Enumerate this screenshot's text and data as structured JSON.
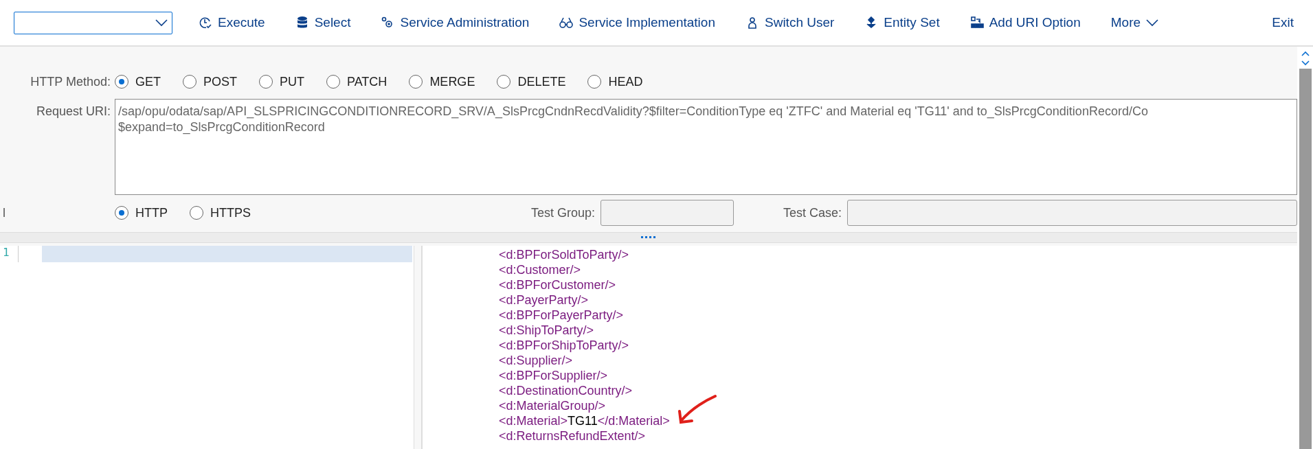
{
  "toolbar": {
    "buttons": [
      {
        "kind": "execute",
        "label": "Execute"
      },
      {
        "kind": "select",
        "label": "Select"
      },
      {
        "kind": "admin",
        "label": "Service Administration"
      },
      {
        "kind": "implementation",
        "label": "Service Implementation"
      },
      {
        "kind": "user",
        "label": "Switch User"
      },
      {
        "kind": "entity",
        "label": "Entity Set"
      },
      {
        "kind": "uri",
        "label": "Add URI Option"
      },
      {
        "kind": "more",
        "label": "More"
      }
    ],
    "exit": "Exit"
  },
  "http_method": {
    "label": "HTTP Method:",
    "options": [
      {
        "label": "GET",
        "selected": true
      },
      {
        "label": "POST",
        "selected": false
      },
      {
        "label": "PUT",
        "selected": false
      },
      {
        "label": "PATCH",
        "selected": false
      },
      {
        "label": "MERGE",
        "selected": false
      },
      {
        "label": "DELETE",
        "selected": false
      },
      {
        "label": "HEAD",
        "selected": false
      }
    ]
  },
  "request_uri": {
    "label": "Request URI:",
    "value": "/sap/opu/odata/sap/API_SLSPRICINGCONDITIONRECORD_SRV/A_SlsPrcgCndnRecdValidity?$filter=ConditionType eq 'ZTFC' and Material eq 'TG11' and to_SlsPrcgConditionRecord/Co\n$expand=to_SlsPrcgConditionRecord"
  },
  "protocol": {
    "label": "l",
    "options": [
      {
        "label": "HTTP",
        "selected": true
      },
      {
        "label": "HTTPS",
        "selected": false
      }
    ]
  },
  "test_group": {
    "label": "Test Group:"
  },
  "test_case": {
    "label": "Test Case:"
  },
  "request_editor": {
    "lines": [
      {
        "number": "1",
        "selected": true
      }
    ]
  },
  "response_xml": [
    {
      "kind": "empty",
      "text": "<d:BPForSoldToParty/>"
    },
    {
      "kind": "empty",
      "text": "<d:Customer/>"
    },
    {
      "kind": "empty",
      "text": "<d:BPForCustomer/>"
    },
    {
      "kind": "empty",
      "text": "<d:PayerParty/>"
    },
    {
      "kind": "empty",
      "text": "<d:BPForPayerParty/>"
    },
    {
      "kind": "empty",
      "text": "<d:ShipToParty/>"
    },
    {
      "kind": "empty",
      "text": "<d:BPForShipToParty/>"
    },
    {
      "kind": "empty",
      "text": "<d:Supplier/>"
    },
    {
      "kind": "empty",
      "text": "<d:BPForSupplier/>"
    },
    {
      "kind": "empty",
      "text": "<d:DestinationCountry/>"
    },
    {
      "kind": "empty",
      "text": "<d:MaterialGroup/>"
    },
    {
      "kind": "value",
      "open": "<d:Material>",
      "value": "TG11",
      "close": "</d:Material>"
    },
    {
      "kind": "empty",
      "text": "<d:ReturnsRefundExtent/>"
    }
  ]
}
